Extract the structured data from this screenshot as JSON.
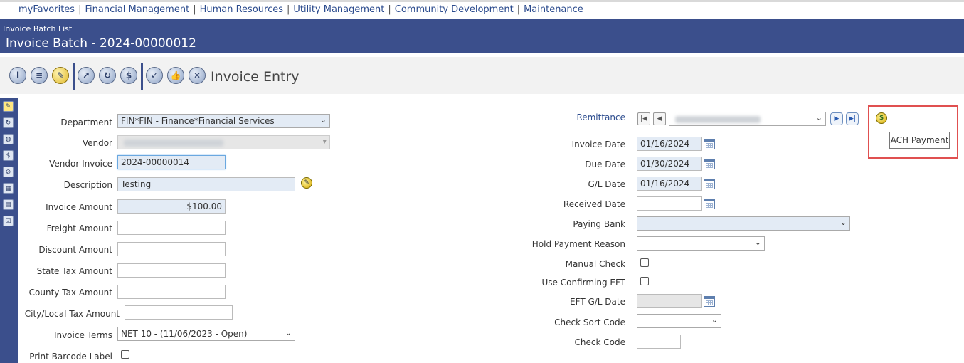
{
  "topnav": {
    "items": [
      "myFavorites",
      "Financial Management",
      "Human Resources",
      "Utility Management",
      "Community Development",
      "Maintenance"
    ],
    "separator": "|"
  },
  "header": {
    "breadcrumb": "Invoice Batch List",
    "title": "Invoice Batch - 2024-00000012"
  },
  "toolbar": {
    "title": "Invoice Entry",
    "icons": [
      "info-icon",
      "list-icon",
      "edit-icon",
      "send-icon",
      "refresh-icon",
      "dollar-icon",
      "approve-icon",
      "thumbs-up-icon",
      "reject-icon"
    ]
  },
  "form_left": {
    "department_label": "Department",
    "department_value": "FIN*FIN - Finance*Financial Services",
    "vendor_label": "Vendor",
    "vendor_invoice_label": "Vendor Invoice",
    "vendor_invoice_value": "2024-00000014",
    "description_label": "Description",
    "description_value": "Testing",
    "invoice_amount_label": "Invoice Amount",
    "invoice_amount_value": "$100.00",
    "freight_amount_label": "Freight Amount",
    "discount_amount_label": "Discount Amount",
    "state_tax_label": "State Tax Amount",
    "county_tax_label": "County Tax Amount",
    "city_tax_label": "City/Local Tax Amount",
    "invoice_terms_label": "Invoice Terms",
    "invoice_terms_value": "NET 10 - (11/06/2023 - Open)",
    "print_barcode_label": "Print Barcode Label"
  },
  "form_right": {
    "remittance_label": "Remittance",
    "invoice_date_label": "Invoice Date",
    "invoice_date_value": "01/16/2024",
    "due_date_label": "Due Date",
    "due_date_value": "01/30/2024",
    "gl_date_label": "G/L Date",
    "gl_date_value": "01/16/2024",
    "received_date_label": "Received Date",
    "paying_bank_label": "Paying Bank",
    "hold_payment_label": "Hold Payment Reason",
    "manual_check_label": "Manual Check",
    "use_confirming_eft_label": "Use Confirming EFT",
    "eft_gl_date_label": "EFT G/L Date",
    "check_sort_code_label": "Check Sort Code",
    "check_code_label": "Check Code"
  },
  "tooltip": {
    "ach_payment": "ACH Payment"
  },
  "colors": {
    "header_bg": "#3b4f8c",
    "link": "#2a4a8d",
    "field_filled": "#e3ebf5",
    "highlight_border": "#e05050"
  }
}
